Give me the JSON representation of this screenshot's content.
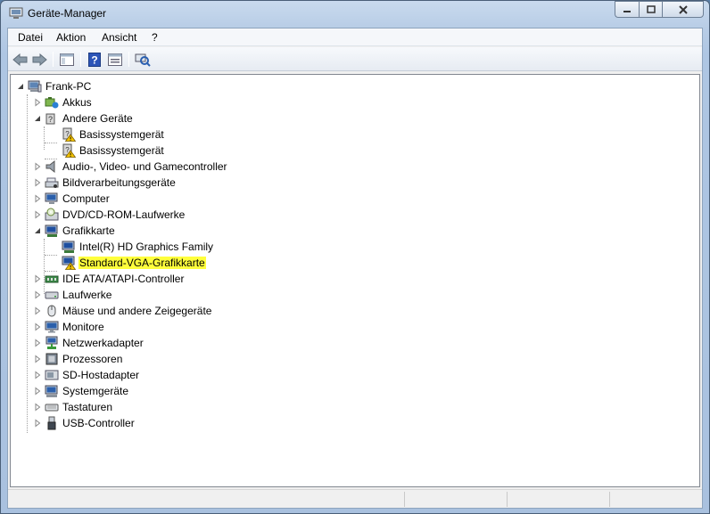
{
  "window": {
    "title": "Geräte-Manager"
  },
  "menu": {
    "items": [
      "Datei",
      "Aktion",
      "Ansicht",
      "?"
    ]
  },
  "toolbar": {
    "buttons": [
      "back-icon",
      "forward-icon",
      "show-hide-console-tree-icon",
      "help-icon",
      "properties-icon",
      "scan-hardware-icon"
    ]
  },
  "tree": {
    "root": "Frank-PC",
    "nodes": [
      {
        "label": "Akkus",
        "icon": "battery-icon",
        "level": 1,
        "expanded": false
      },
      {
        "label": "Andere Geräte",
        "icon": "unknown-device-icon",
        "level": 1,
        "expanded": true
      },
      {
        "label": "Basissystemgerät",
        "icon": "warning-device-icon",
        "level": 2
      },
      {
        "label": "Basissystemgerät",
        "icon": "warning-device-icon",
        "level": 2
      },
      {
        "label": "Audio-, Video- und Gamecontroller",
        "icon": "speaker-icon",
        "level": 1,
        "expanded": false
      },
      {
        "label": "Bildverarbeitungsgeräte",
        "icon": "scanner-icon",
        "level": 1,
        "expanded": false
      },
      {
        "label": "Computer",
        "icon": "computer-icon",
        "level": 1,
        "expanded": false
      },
      {
        "label": "DVD/CD-ROM-Laufwerke",
        "icon": "dvd-drive-icon",
        "level": 1,
        "expanded": false
      },
      {
        "label": "Grafikkarte",
        "icon": "display-adapter-icon",
        "level": 1,
        "expanded": true
      },
      {
        "label": "Intel(R) HD Graphics Family",
        "icon": "display-adapter-icon",
        "level": 2
      },
      {
        "label": "Standard-VGA-Grafikkarte",
        "icon": "warning-display-icon",
        "level": 2,
        "highlight": true
      },
      {
        "label": "IDE ATA/ATAPI-Controller",
        "icon": "ide-controller-icon",
        "level": 1,
        "expanded": false
      },
      {
        "label": "Laufwerke",
        "icon": "disk-drive-icon",
        "level": 1,
        "expanded": false
      },
      {
        "label": "Mäuse und andere Zeigegeräte",
        "icon": "mouse-icon",
        "level": 1,
        "expanded": false
      },
      {
        "label": "Monitore",
        "icon": "monitor-icon",
        "level": 1,
        "expanded": false
      },
      {
        "label": "Netzwerkadapter",
        "icon": "network-adapter-icon",
        "level": 1,
        "expanded": false
      },
      {
        "label": "Prozessoren",
        "icon": "processor-icon",
        "level": 1,
        "expanded": false
      },
      {
        "label": "SD-Hostadapter",
        "icon": "sd-host-icon",
        "level": 1,
        "expanded": false
      },
      {
        "label": "Systemgeräte",
        "icon": "system-devices-icon",
        "level": 1,
        "expanded": false
      },
      {
        "label": "Tastaturen",
        "icon": "keyboard-icon",
        "level": 1,
        "expanded": false
      },
      {
        "label": "USB-Controller",
        "icon": "usb-icon",
        "level": 1,
        "expanded": false
      }
    ]
  },
  "colors": {
    "highlight": "#ffff3c",
    "warning": "#f5c400",
    "tree_bg": "#ffffff"
  }
}
